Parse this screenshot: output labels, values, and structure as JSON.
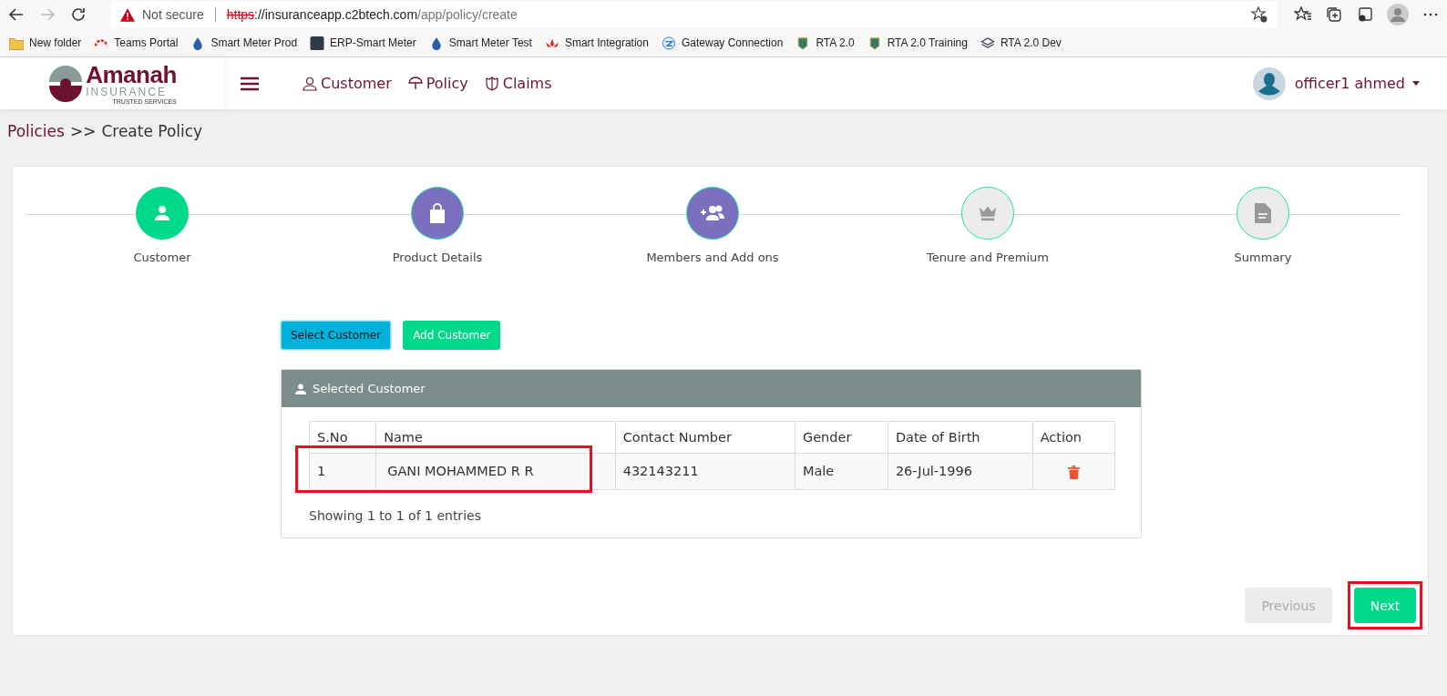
{
  "browser": {
    "security_label": "Not secure",
    "url_scheme": "https",
    "url_host": "://insuranceapp.c2btech.com",
    "url_path": "/app/policy/create",
    "bookmarks": [
      {
        "label": "New folder",
        "kind": "folder"
      },
      {
        "label": "Teams Portal",
        "kind": "arc"
      },
      {
        "label": "Smart Meter Prod",
        "kind": "drop"
      },
      {
        "label": "ERP-Smart Meter",
        "kind": "tile"
      },
      {
        "label": "Smart Meter Test",
        "kind": "drop"
      },
      {
        "label": "Smart Integration",
        "kind": "lotus"
      },
      {
        "label": "Gateway Connection",
        "kind": "globe"
      },
      {
        "label": "RTA 2.0",
        "kind": "emblem"
      },
      {
        "label": "RTA 2.0 Training",
        "kind": "emblem"
      },
      {
        "label": "RTA 2.0 Dev",
        "kind": "layers"
      }
    ]
  },
  "header": {
    "logo_title": "Amanah",
    "logo_subtitle": "INSURANCE",
    "logo_tagline": "TRUSTED SERVICES",
    "nav": [
      {
        "label": "Customer",
        "kind": "person"
      },
      {
        "label": "Policy",
        "kind": "umbrella"
      },
      {
        "label": "Claims",
        "kind": "shield"
      }
    ],
    "user": "officer1 ahmed"
  },
  "breadcrumb": {
    "parent": "Policies",
    "separator": ">>",
    "current": "Create Policy"
  },
  "steps": [
    {
      "label": "Customer",
      "completed": true,
      "visited": true,
      "kind": "person"
    },
    {
      "label": "Product Details",
      "completed": false,
      "visited": true,
      "kind": "bag"
    },
    {
      "label": "Members and Add ons",
      "completed": false,
      "visited": true,
      "kind": "people"
    },
    {
      "label": "Tenure and Premium",
      "completed": false,
      "visited": false,
      "kind": "crown"
    },
    {
      "label": "Summary",
      "completed": false,
      "visited": false,
      "kind": "document"
    }
  ],
  "actions": [
    {
      "label": "Select Customer",
      "selected": true
    },
    {
      "label": "Add Customer",
      "selected": false
    }
  ],
  "panel": {
    "title": "Selected Customer",
    "table": {
      "columns": [
        "S.No",
        "Name",
        "Contact Number",
        "Gender",
        "Date of Birth",
        "Action"
      ],
      "rows": [
        {
          "sno": "1",
          "name": "GANI MOHAMMED R R",
          "contact": "432143211",
          "gender": "Male",
          "dob": "26-Jul-1996",
          "highlighted": true
        }
      ]
    },
    "footer": "Showing 1 to 1 of 1 entries"
  },
  "nav_buttons": [
    {
      "label": "Previous",
      "disabled": true,
      "highlighted": false
    },
    {
      "label": "Next",
      "disabled": false,
      "highlighted": true
    }
  ]
}
